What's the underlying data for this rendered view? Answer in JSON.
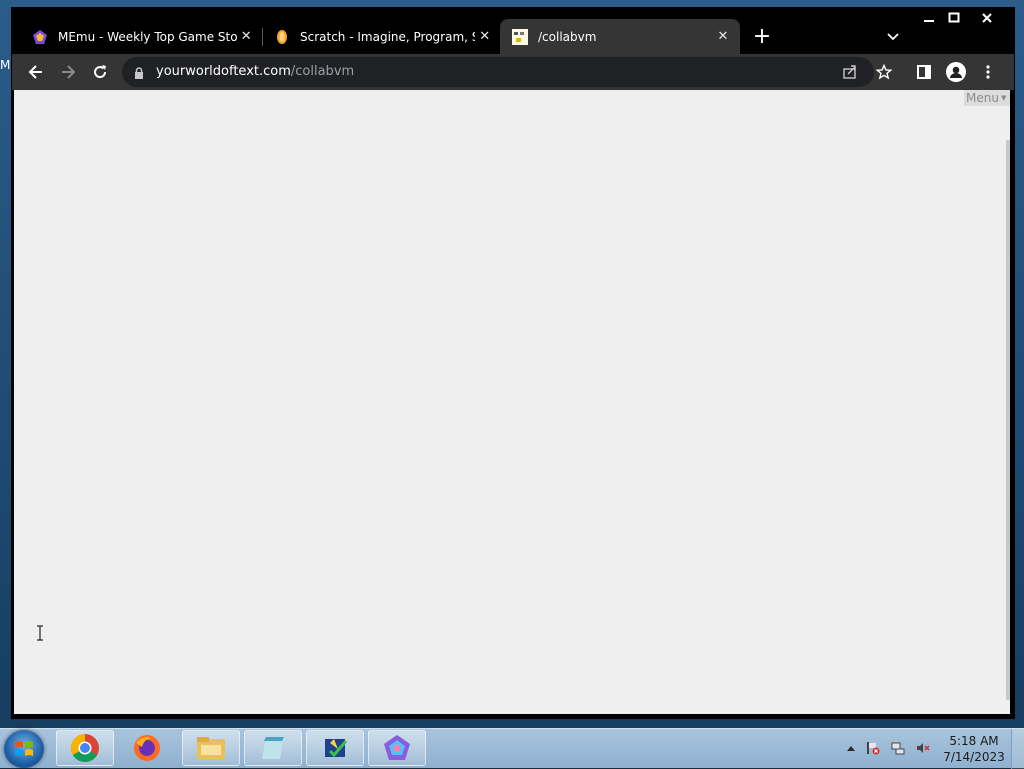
{
  "desktop": {
    "label": "M"
  },
  "browser": {
    "tabs": [
      {
        "title": "MEmu - Weekly Top Game Stories",
        "icon": "memu-icon",
        "active": false
      },
      {
        "title": "Scratch - Imagine, Program, Share",
        "icon": "scratch-icon",
        "active": false
      },
      {
        "title": "/collabvm",
        "icon": "ywot-icon",
        "active": true
      }
    ],
    "url_domain": "yourworldoftext.com",
    "url_path": "/collabvm"
  },
  "page": {
    "menu_label": "Menu"
  },
  "taskbar": {
    "apps": [
      {
        "name": "chrome-icon"
      },
      {
        "name": "firefox-icon"
      },
      {
        "name": "file-explorer-icon"
      },
      {
        "name": "notepad-icon"
      },
      {
        "name": "app-checklist-icon"
      },
      {
        "name": "memu-icon"
      }
    ],
    "clock": {
      "time": "5:18 AM",
      "date": "7/14/2023"
    }
  },
  "colors": {
    "page_bg": "#efefef",
    "chrome_dark": "#000000",
    "toolbar": "#353535"
  }
}
